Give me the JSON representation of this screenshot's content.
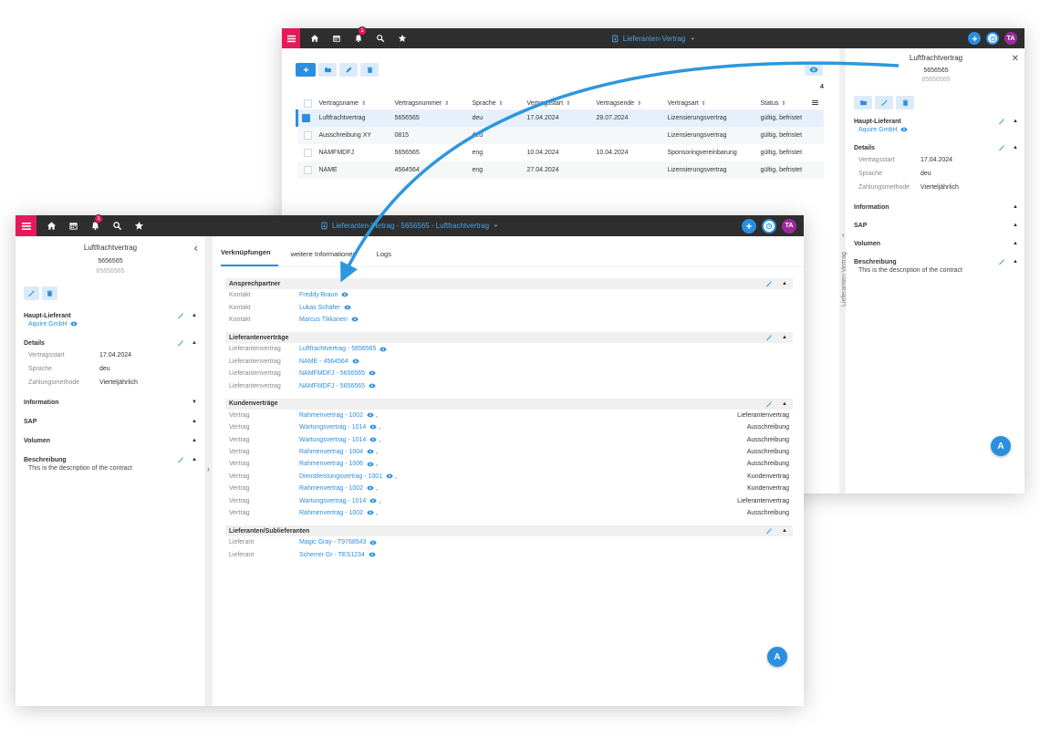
{
  "app": {
    "notification_count": "1",
    "user_initials": "TA",
    "plus": "+",
    "fab_label": "A"
  },
  "back": {
    "title": "Lieferanten-Vertrag",
    "table": {
      "headers": [
        "Vertragsname",
        "Vertragsnummer",
        "Sprache",
        "Vertragsstart",
        "Vertragsende",
        "Vertragsart",
        "Status"
      ],
      "count": "4",
      "rows": [
        {
          "name": "Luftfrachtvertrag",
          "nummer": "5656565",
          "sprache": "deu",
          "start": "17.04.2024",
          "ende": "28.07.2024",
          "art": "Lizensierungsvertrag",
          "status": "gültig, befristet"
        },
        {
          "name": "Ausschreibung XY",
          "nummer": "0815",
          "sprache": "deu",
          "start": "",
          "ende": "",
          "art": "Lizensierungsvertrag",
          "status": "gültig, befristet"
        },
        {
          "name": "NAMFMDFJ",
          "nummer": "5656565",
          "sprache": "eng",
          "start": "10.04.2024",
          "ende": "10.04.2024",
          "art": "Sponsoringvereinbarung",
          "status": "gültig, befristet"
        },
        {
          "name": "NAME",
          "nummer": "4564564",
          "sprache": "eng",
          "start": "27.04.2024",
          "ende": "",
          "art": "Lizensierungsvertrag",
          "status": "gültig, befristet"
        }
      ]
    },
    "vertical_tab": "Lieferanten-Vertrag",
    "close_label": "✕"
  },
  "detail": {
    "title": "Luftfrachtvertrag",
    "number": "5656565",
    "subnumber": "85656565",
    "haupt_lieferant_label": "Haupt-Lieferant",
    "haupt_lieferant_value": "Aquire GmbH",
    "details_label": "Details",
    "details": [
      {
        "k": "Vertragsstart",
        "v": "17.04.2024"
      },
      {
        "k": "Sprache",
        "v": "deu"
      },
      {
        "k": "Zahlungsmethode",
        "v": "Vierteljährlich"
      }
    ],
    "information_label": "Information",
    "sap_label": "SAP",
    "volumen_label": "Volumen",
    "beschreibung_label": "Beschreibung",
    "beschreibung_text": "This is the description of the contract"
  },
  "front": {
    "title": "Lieferanten-Vertrag - 5656565 - Luftfrachtvertrag",
    "tabs": [
      "Verknüpfungen",
      "weitere Informationen",
      "Logs"
    ],
    "groups": {
      "ansprechpartner": {
        "title": "Ansprechpartner",
        "rows": [
          {
            "k": "Kontakt",
            "v": "Freddy Braun"
          },
          {
            "k": "Kontakt",
            "v": "Lukas Schäfer"
          },
          {
            "k": "Kontakt",
            "v": "Marcus Tikkanen"
          }
        ]
      },
      "lieferantenvertraege": {
        "title": "Lieferantenverträge",
        "rows": [
          {
            "k": "Lieferantenvertrag",
            "v": "Luftfrachtvertrag - 5656565"
          },
          {
            "k": "Lieferantenvertrag",
            "v": "NAME - 4564564"
          },
          {
            "k": "Lieferantenvertrag",
            "v": "NAMFMDFJ - 5656565"
          },
          {
            "k": "Lieferantenvertrag",
            "v": "NAMFMDFJ - 5656565"
          }
        ]
      },
      "kundenvertraege": {
        "title": "Kundenverträge",
        "rows": [
          {
            "k": "Vertrag",
            "v": "Rahmenvertrag - 1002",
            "r": "Lieferantenvertrag"
          },
          {
            "k": "Vertrag",
            "v": "Wartungsvertrag - 1014",
            "r": "Ausschreibung"
          },
          {
            "k": "Vertrag",
            "v": "Wartungsvertrag - 1014",
            "r": "Ausschreibung"
          },
          {
            "k": "Vertrag",
            "v": "Rahmenvertrag - 1004",
            "r": "Ausschreibung"
          },
          {
            "k": "Vertrag",
            "v": "Rahmenvertrag - 1006",
            "r": "Ausschreibung"
          },
          {
            "k": "Vertrag",
            "v": "Dienstleistungsvertrag - 1001",
            "r": "Kundenvertrag"
          },
          {
            "k": "Vertrag",
            "v": "Rahmenvertrag - 1002",
            "r": "Kundenvertrag"
          },
          {
            "k": "Vertrag",
            "v": "Wartungsvertrag - 1014",
            "r": "Lieferantenvertrag"
          },
          {
            "k": "Vertrag",
            "v": "Rahmenvertrag - 1002",
            "r": "Ausschreibung"
          }
        ]
      },
      "sublieferanten": {
        "title": "Lieferanten/Sublieferanten",
        "rows": [
          {
            "k": "Lieferant",
            "v": "Magic Gray - T9768543"
          },
          {
            "k": "Lieferant",
            "v": "Scherrer Gr - TES1234"
          }
        ]
      }
    }
  },
  "colors": {
    "accent": "#2a8fe0",
    "menu": "#e6195a",
    "topbar": "#2e2e2e",
    "avatar": "#9b2b9a"
  }
}
